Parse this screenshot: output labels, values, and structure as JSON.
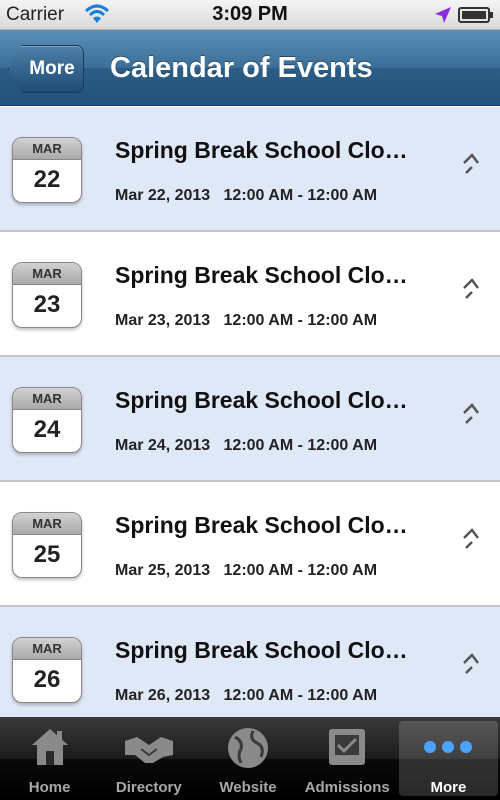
{
  "status_bar": {
    "carrier": "Carrier",
    "time": "3:09 PM",
    "icons": [
      "wifi-icon",
      "location-icon",
      "battery-icon"
    ]
  },
  "nav": {
    "back_label": "More",
    "title": "Calendar of Events"
  },
  "events": [
    {
      "month": "MAR",
      "day": "22",
      "title": "Spring Break School Clo…",
      "datetime": "Mar 22, 2013   12:00 AM - 12:00 AM"
    },
    {
      "month": "MAR",
      "day": "23",
      "title": "Spring Break School Clo…",
      "datetime": "Mar 23, 2013   12:00 AM - 12:00 AM"
    },
    {
      "month": "MAR",
      "day": "24",
      "title": "Spring Break School Clo…",
      "datetime": "Mar 24, 2013   12:00 AM - 12:00 AM"
    },
    {
      "month": "MAR",
      "day": "25",
      "title": "Spring Break School Clo…",
      "datetime": "Mar 25, 2013   12:00 AM - 12:00 AM"
    },
    {
      "month": "MAR",
      "day": "26",
      "title": "Spring Break School Clo…",
      "datetime": "Mar 26, 2013   12:00 AM - 12:00 AM"
    }
  ],
  "tabs": [
    {
      "label": "Home",
      "icon": "home-icon"
    },
    {
      "label": "Directory",
      "icon": "handshake-icon"
    },
    {
      "label": "Website",
      "icon": "globe-icon"
    },
    {
      "label": "Admissions",
      "icon": "inbox-icon"
    },
    {
      "label": "More",
      "icon": "more-dots-icon",
      "active": true
    }
  ],
  "colors": {
    "nav_bar": "#2b5d86",
    "shaded_row": "#dfe8f7",
    "active_tab_dots": "#4aa3ff"
  }
}
